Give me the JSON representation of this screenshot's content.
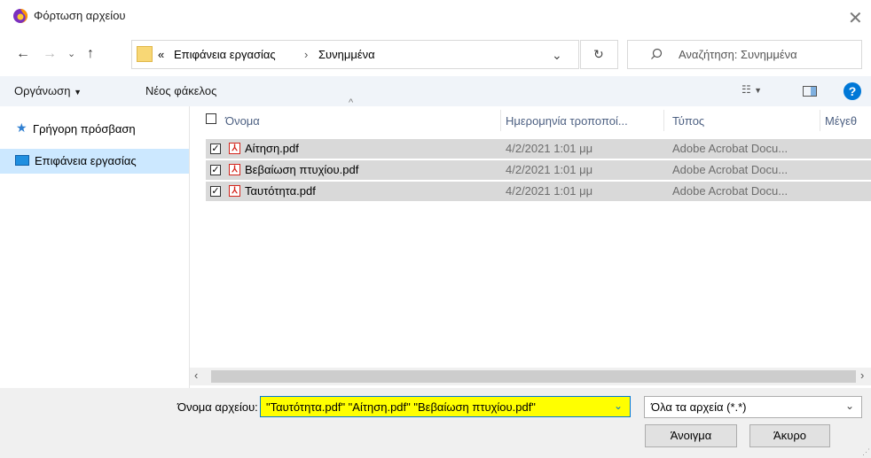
{
  "window": {
    "title": "Φόρτωση αρχείου"
  },
  "address": {
    "overflow": "«",
    "crumbs": [
      "Επιφάνεια εργασίας",
      "Συνημμένα"
    ],
    "separator": "›"
  },
  "search": {
    "placeholder": "Αναζήτηση: Συνημμένα"
  },
  "toolbar": {
    "organize": "Οργάνωση",
    "new_folder": "Νέος φάκελος"
  },
  "sidebar": {
    "items": [
      {
        "label": "Γρήγορη πρόσβαση"
      },
      {
        "label": "Επιφάνεια εργασίας"
      }
    ]
  },
  "columns": {
    "name": "Όνομα",
    "date": "Ημερομηνία τροποποί...",
    "type": "Τύπος",
    "size": "Μέγεθ"
  },
  "files": [
    {
      "name": "Αίτηση.pdf",
      "date": "4/2/2021 1:01 μμ",
      "type": "Adobe Acrobat Docu..."
    },
    {
      "name": "Βεβαίωση πτυχίου.pdf",
      "date": "4/2/2021 1:01 μμ",
      "type": "Adobe Acrobat Docu..."
    },
    {
      "name": "Ταυτότητα.pdf",
      "date": "4/2/2021 1:01 μμ",
      "type": "Adobe Acrobat Docu..."
    }
  ],
  "footer": {
    "filename_label": "Όνομα αρχείου:",
    "filename_value": "\"Ταυτότητα.pdf\" \"Αίτηση.pdf\" \"Βεβαίωση πτυχίου.pdf\"",
    "filter": "Όλα τα αρχεία (*.*)",
    "open": "Άνοιγμα",
    "cancel": "Άκυρο"
  },
  "colors": {
    "accent": "#0078d7",
    "selected_bg": "#cce8ff",
    "row_selected": "#d9d9d9",
    "highlight": "#ffff00",
    "help": "#0078d7"
  },
  "icons": [
    "firefox-icon",
    "close-icon",
    "back-arrow-icon",
    "forward-arrow-icon",
    "chevron-down-icon",
    "up-arrow-icon",
    "folder-icon",
    "refresh-icon",
    "search-icon",
    "view-options-icon",
    "preview-pane-icon",
    "help-icon",
    "star-icon",
    "desktop-icon",
    "checkbox-icon",
    "pdf-icon"
  ]
}
